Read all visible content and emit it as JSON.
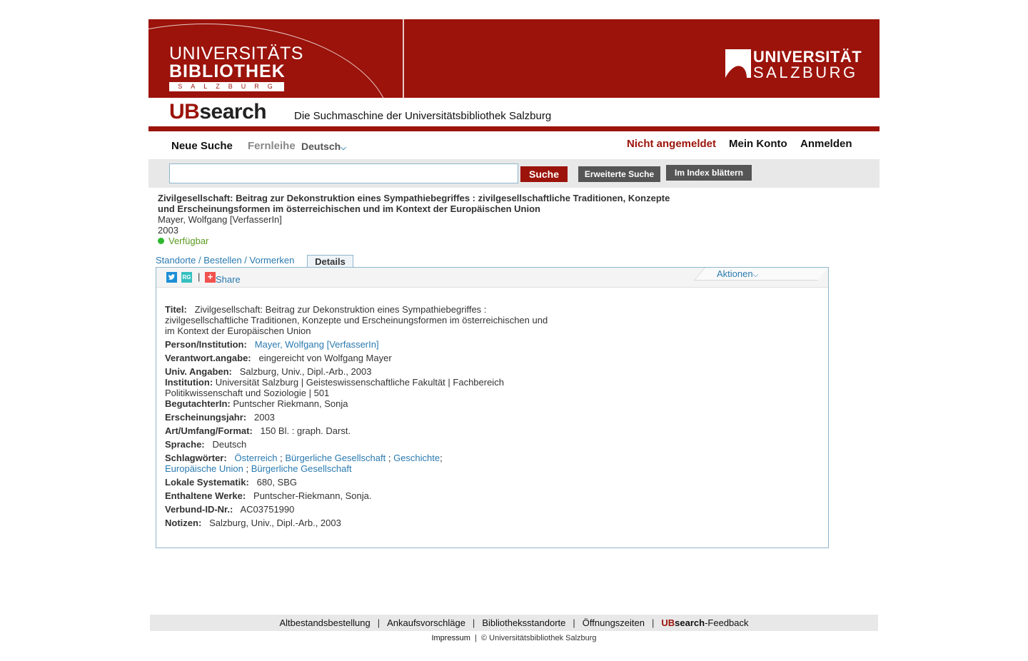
{
  "header": {
    "ub_logo": {
      "line1": "UNIVERSITÄTS",
      "line2": "BIBLIOTHEK",
      "line3": "SALZBURG"
    },
    "uni_logo": {
      "line1": "UNIVERSITÄT",
      "line2": "SALZBURG"
    },
    "brand_prefix": "UB",
    "brand_suffix": "search",
    "tagline": "Die Suchmaschine der Universitätsbibliothek Salzburg"
  },
  "nav": {
    "new_search": "Neue Suche",
    "interlibrary": "Fernleihe",
    "language": "Deutsch",
    "login_status": "Nicht angemeldet",
    "my_account": "Mein Konto",
    "login": "Anmelden"
  },
  "search": {
    "value": "",
    "submit": "Suche",
    "advanced": "Erweiterte Suche",
    "browse_index": "Im Index blättern"
  },
  "record": {
    "title_line1": "Zivilgesellschaft: Beitrag zur Dekonstruktion eines Sympathiebegriffes : zivilgesellschaftliche Traditionen, Konzepte",
    "title_line2": "und Erscheinungsformen im österreichischen und im Kontext der Europäischen Union",
    "author": "Mayer, Wolfgang [VerfasserIn]",
    "year": "2003",
    "availability": "Verfügbar"
  },
  "tabs": {
    "locations": "Standorte / Bestellen / Vormerken",
    "details": "Details"
  },
  "toolbar": {
    "share_label": "Share",
    "actions_label": "Aktionen",
    "divider": "|"
  },
  "details": {
    "title_label": "Titel:",
    "title_value_1": "Zivilgesellschaft: Beitrag zur Dekonstruktion eines Sympathiebegriffes :",
    "title_value_2": "zivilgesellschaftliche Traditionen, Konzepte und Erscheinungsformen im österreichischen und",
    "title_value_3": "im Kontext der Europäischen Union",
    "person_label": "Person/Institution:",
    "person_value": "Mayer, Wolfgang [VerfasserIn]",
    "resp_label": "Verantwort.angabe:",
    "resp_value": "eingereicht von Wolfgang Mayer",
    "univ_label": "Univ. Angaben:",
    "univ_value": "Salzburg, Univ., Dipl.-Arb., 2003",
    "inst_label": "Institution:",
    "inst_value_1": "Universität Salzburg | Geisteswissenschaftliche Fakultät | Fachbereich",
    "inst_value_2": "Politikwissenschaft und Soziologie | 501",
    "reviewer_label": "BegutachterIn:",
    "reviewer_value": "Puntscher Riekmann, Sonja",
    "year_label": "Erscheinungsjahr:",
    "year_value": "2003",
    "format_label": "Art/Umfang/Format:",
    "format_value": "150 Bl. : graph. Darst.",
    "lang_label": "Sprache:",
    "lang_value": "Deutsch",
    "subjects_label": "Schlagwörter:",
    "subjects": [
      "Österreich",
      "Bürgerliche Gesellschaft",
      "Geschichte",
      "Europäische Union",
      "Bürgerliche Gesellschaft"
    ],
    "local_label": "Lokale Systematik:",
    "local_value": "680, SBG",
    "contained_label": "Enthaltene Werke:",
    "contained_value": "Puntscher-Riekmann, Sonja.",
    "verbund_label": "Verbund-ID-Nr.:",
    "verbund_value": "AC03751990",
    "notes_label": "Notizen:",
    "notes_value": "Salzburg, Univ., Dipl.-Arb., 2003"
  },
  "footer": {
    "links": [
      "Altbestandsbestellung",
      "Ankaufsvorschläge",
      "Bibliotheksstandorte",
      "Öffnungszeiten"
    ],
    "feedback_prefix": "UB",
    "feedback_mid": "search",
    "feedback_suffix": "-Feedback",
    "imprint": "Impressum",
    "copyright": "© Universitätsbibliothek Salzburg",
    "separator": "|"
  },
  "colors": {
    "brand_red": "#9b130b",
    "link_blue": "#2a7ab0",
    "available_green": "#5a9a1f"
  }
}
